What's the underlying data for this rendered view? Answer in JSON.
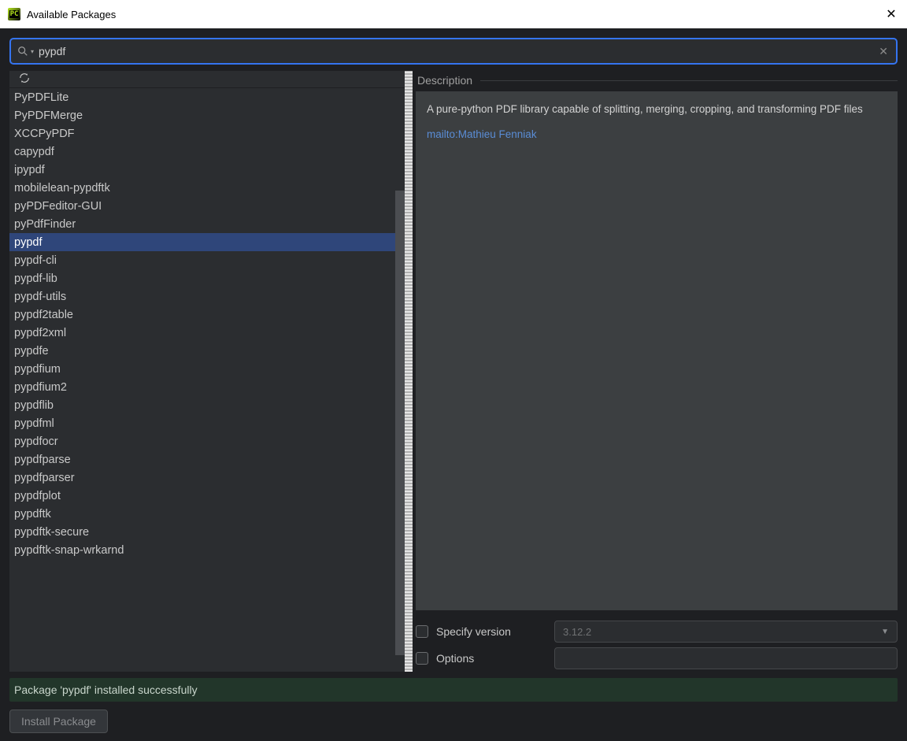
{
  "window": {
    "title": "Available Packages"
  },
  "search": {
    "value": "pypdf"
  },
  "packages": [
    "PyPDFLite",
    "PyPDFMerge",
    "XCCPyPDF",
    "capypdf",
    "ipypdf",
    "mobilelean-pypdftk",
    "pyPDFeditor-GUI",
    "pyPdfFinder",
    "pypdf",
    "pypdf-cli",
    "pypdf-lib",
    "pypdf-utils",
    "pypdf2table",
    "pypdf2xml",
    "pypdfe",
    "pypdfium",
    "pypdfium2",
    "pypdflib",
    "pypdfml",
    "pypdfocr",
    "pypdfparse",
    "pypdfparser",
    "pypdfplot",
    "pypdftk",
    "pypdftk-secure",
    "pypdftk-snap-wrkarnd"
  ],
  "selected_index": 8,
  "description": {
    "heading": "Description",
    "text": "A pure-python PDF library capable of splitting, merging, cropping, and transforming PDF files",
    "link": "mailto:Mathieu Fenniak"
  },
  "options": {
    "specify_version_label": "Specify version",
    "version_value": "3.12.2",
    "options_label": "Options",
    "options_value": ""
  },
  "status": "Package 'pypdf' installed successfully",
  "install_button": "Install Package"
}
